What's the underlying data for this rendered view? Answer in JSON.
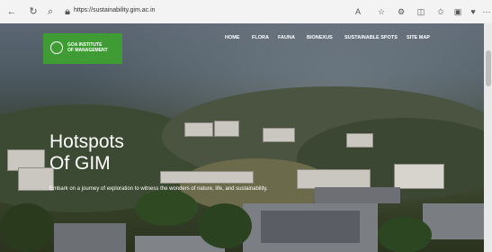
{
  "browser": {
    "url": "https://sustainability.gim.ac.in",
    "icons": [
      "back-icon",
      "refresh-icon",
      "search-icon",
      "lock-icon",
      "read-aloud-icon",
      "favorite-icon",
      "extensions-icon",
      "split-screen-icon",
      "favorites-icon",
      "collections-icon",
      "browser-essentials-icon",
      "more-icon"
    ]
  },
  "header": {
    "logo_line1": "GOA INSTITUTE",
    "logo_line2": "OF MANAGEMENT",
    "nav": [
      "HOME",
      "FLORA",
      "FAUNA",
      "BIONEXUS",
      "SUSTAINABLE SPOTS",
      "SITE MAP"
    ]
  },
  "hero": {
    "title_line1": "Hotspots",
    "title_line2": "Of GIM",
    "subtitle": "Embark on a journey of exploration to witness the wonders of nature, life, and sustainability."
  },
  "colors": {
    "logo_bg": "#3f9c34"
  }
}
